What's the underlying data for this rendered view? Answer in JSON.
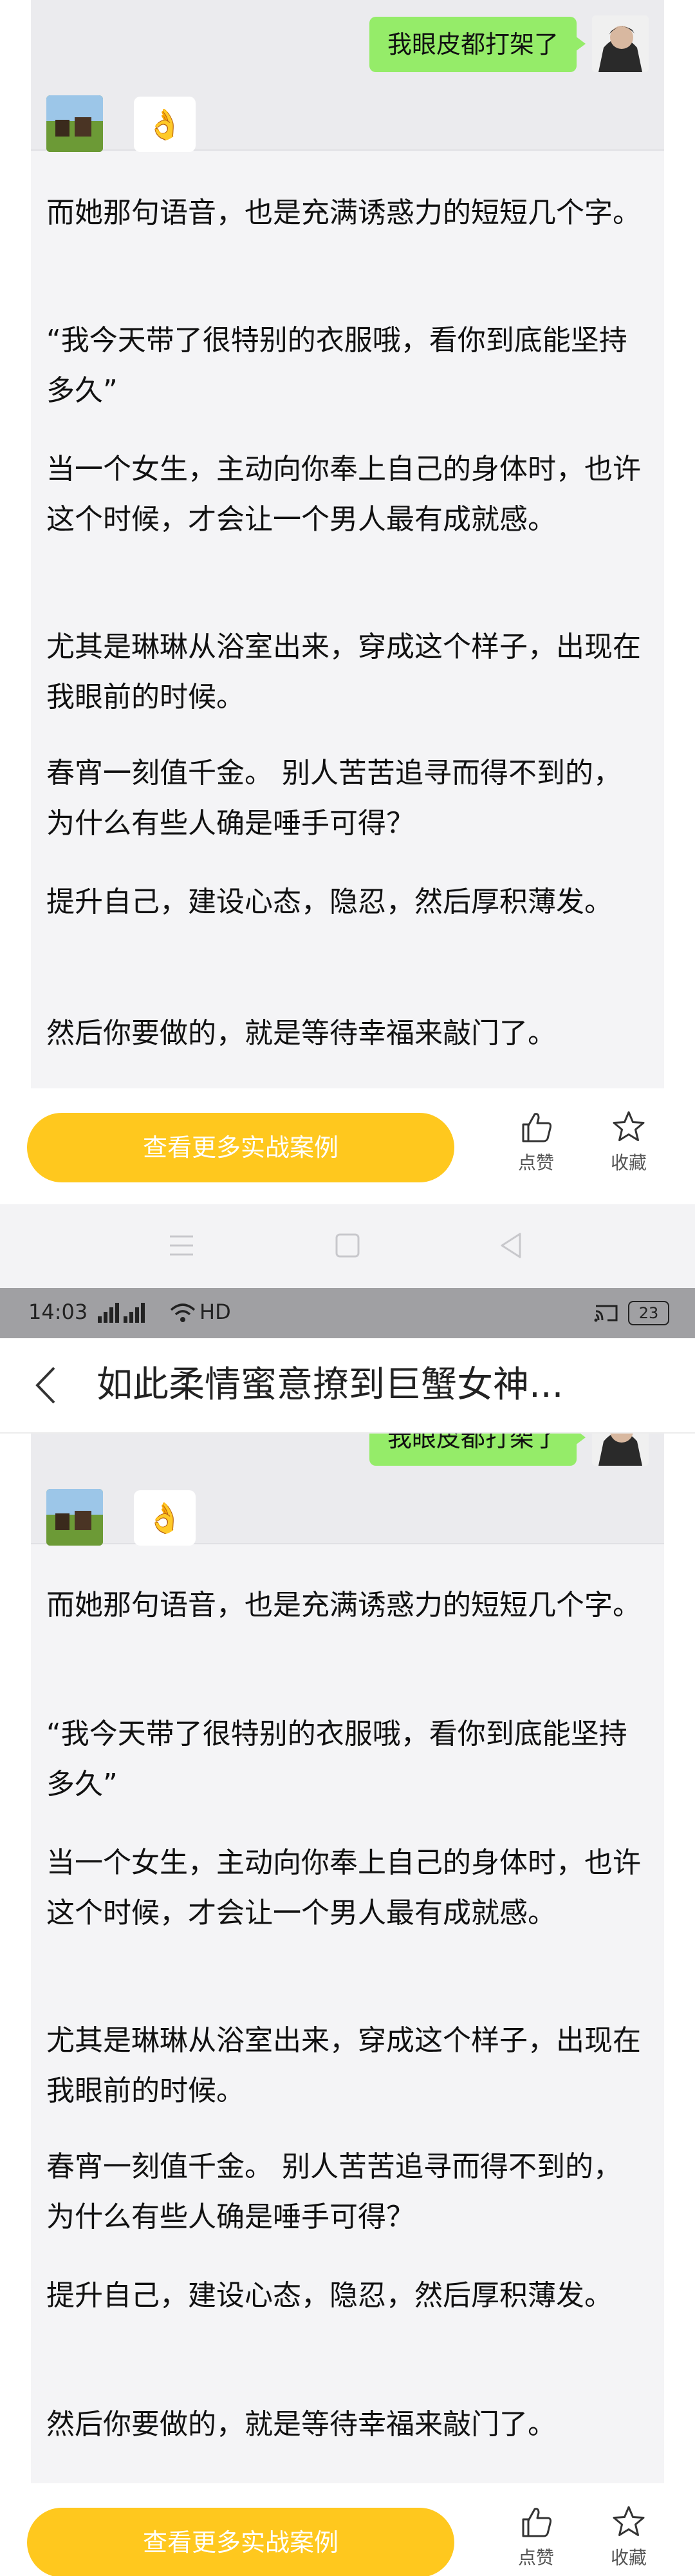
{
  "chat": {
    "outgoing_message": "我眼皮都打架了",
    "incoming_emoji": "👌"
  },
  "article": {
    "paragraphs": [
      "而她那句语音，也是充满诱惑力的短短几个字。",
      "“我今天带了很特别的衣服哦，看你到底能坚持多久”",
      "当一个女生，主动向你奉上自己的身体时，也许这个时候，才会让一个男人最有成就感。",
      "尤其是琳琳从浴室出来，穿成这个样子，出现在我眼前的时候。",
      "春宵一刻值千金。 别人苦苦追寻而得不到的，为什么有些人确是唾手可得？",
      "提升自己，建设心态，隐忍，然后厚积薄发。",
      "然后你要做的，就是等待幸福来敲门了。"
    ]
  },
  "actions": {
    "cta_label": "查看更多实战案例",
    "like_label": "点赞",
    "favorite_label": "收藏"
  },
  "status_bar": {
    "time": "14:03",
    "network": "HD",
    "battery": "23"
  },
  "header": {
    "title": "如此柔情蜜意撩到巨蟹女神..."
  },
  "colors": {
    "accent": "#ffc81e",
    "chat_bubble": "#95ec69",
    "status_bar": "#a0a0a3"
  }
}
